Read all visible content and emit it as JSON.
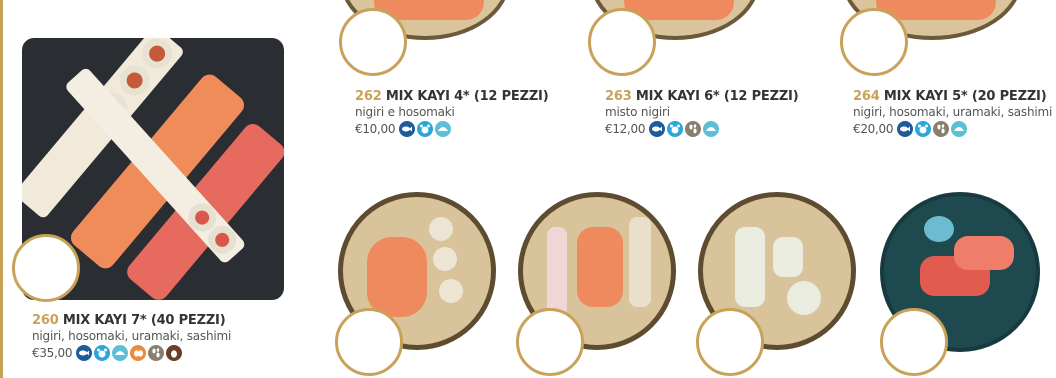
{
  "items": [
    {
      "num": "260",
      "name": "MIX KAYI 7* (40 PEZZI)",
      "desc": "nigiri, hosomaki, uramaki, sashimi",
      "price": "€35,00",
      "allergens": [
        "fish-icon",
        "crustacean-icon",
        "mollusc-icon",
        "egg-icon",
        "sesame-icon",
        "soy-icon"
      ]
    },
    {
      "num": "262",
      "name": "MIX KAYI 4* (12 PEZZI)",
      "desc": "nigiri e hosomaki",
      "price": "€10,00",
      "allergens": [
        "fish-icon",
        "crustacean-icon",
        "mollusc-icon"
      ]
    },
    {
      "num": "263",
      "name": "MIX KAYI 6* (12 PEZZI)",
      "desc": "misto nigiri",
      "price": "€12,00",
      "allergens": [
        "fish-icon",
        "crustacean-icon",
        "sesame-icon",
        "mollusc-icon"
      ]
    },
    {
      "num": "264",
      "name": "MIX KAYI 5* (20 PEZZI)",
      "desc": "nigiri, hosomaki, uramaki, sashimi",
      "price": "€20,00",
      "allergens": [
        "fish-icon",
        "crustacean-icon",
        "sesame-icon",
        "mollusc-icon"
      ]
    }
  ],
  "colors": {
    "accent": "#c9a25a",
    "fish": "#1f5b9a",
    "crustacean": "#2aa7d6",
    "mollusc": "#5bbfd6",
    "egg": "#ee8a3c",
    "sesame": "#8a7f6e",
    "soy": "#6b3e26"
  }
}
